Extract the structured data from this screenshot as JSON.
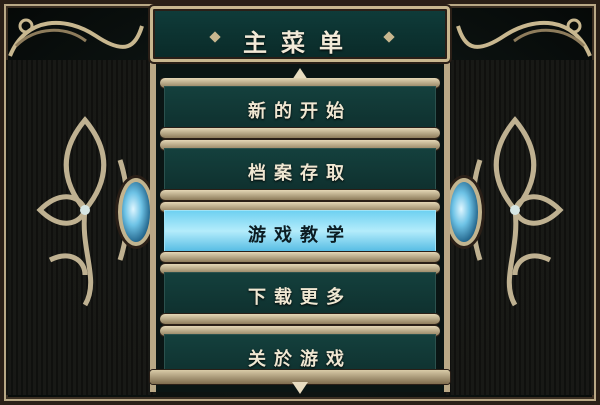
{
  "header": {
    "title": "主菜单"
  },
  "menu": {
    "items": [
      {
        "label": "新的开始",
        "selected": false
      },
      {
        "label": "档案存取",
        "selected": false
      },
      {
        "label": "游戏教学",
        "selected": true
      },
      {
        "label": "下载更多",
        "selected": false
      },
      {
        "label": "关於游戏",
        "selected": false
      }
    ]
  },
  "colors": {
    "item_bg": "#14403d",
    "item_selected_bg": "#b4ecfb",
    "frame": "#b9a886",
    "title_bg": "#0f3c3a"
  },
  "icons": {
    "scroll_up": "arrow-up-icon",
    "scroll_down": "arrow-down-icon",
    "left_ornament": "fleur-de-lis-icon",
    "right_ornament": "fleur-de-lis-icon"
  }
}
